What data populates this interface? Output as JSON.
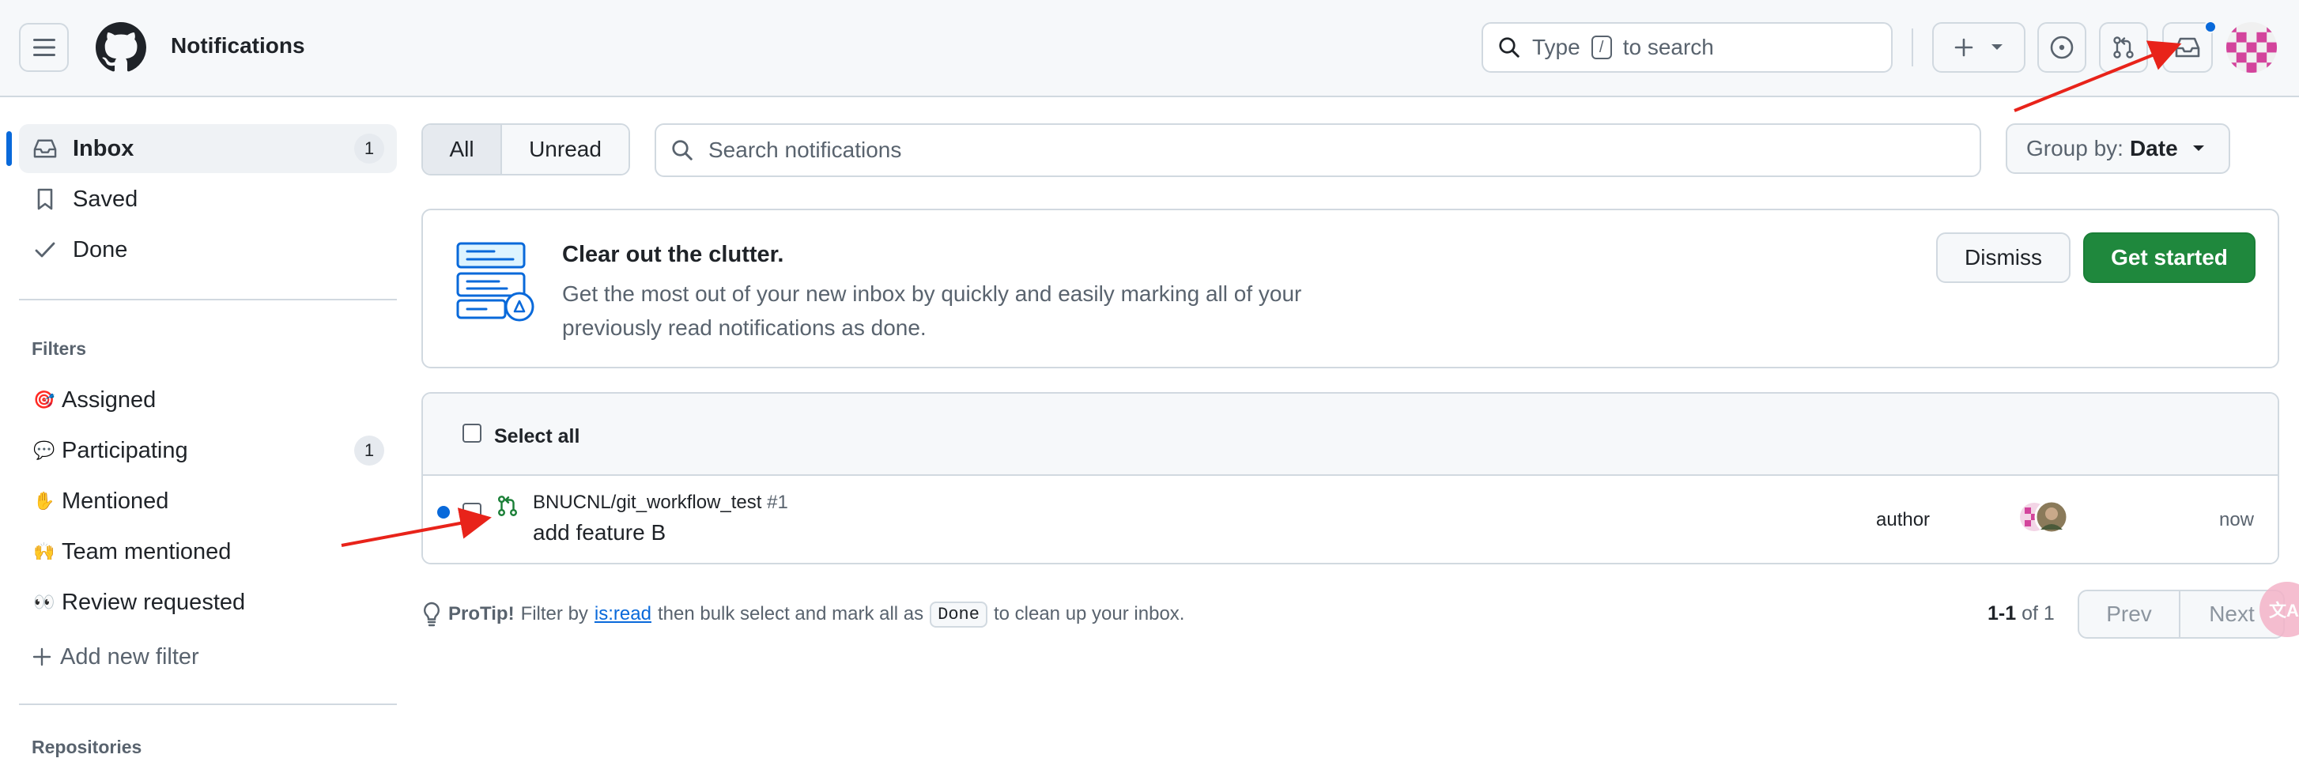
{
  "header": {
    "title": "Notifications",
    "search_prefix": "Type",
    "search_key": "/",
    "search_suffix": "to search"
  },
  "sidebar": {
    "items": [
      {
        "label": "Inbox",
        "count": "1"
      },
      {
        "label": "Saved"
      },
      {
        "label": "Done"
      }
    ],
    "filters_heading": "Filters",
    "filters": [
      {
        "emoji": "🎯",
        "label": "Assigned"
      },
      {
        "emoji": "💬",
        "label": "Participating",
        "count": "1"
      },
      {
        "emoji": "✋",
        "label": "Mentioned"
      },
      {
        "emoji": "🙌",
        "label": "Team mentioned"
      },
      {
        "emoji": "👀",
        "label": "Review requested"
      }
    ],
    "add_filter": "Add new filter",
    "repositories_heading": "Repositories"
  },
  "toolbar": {
    "tab_all": "All",
    "tab_unread": "Unread",
    "search_placeholder": "Search notifications",
    "groupby_label": "Group by:",
    "groupby_value": "Date"
  },
  "banner": {
    "title": "Clear out the clutter.",
    "description": "Get the most out of your new inbox by quickly and easily marking all of your previously read notifications as done.",
    "dismiss": "Dismiss",
    "get_started": "Get started"
  },
  "list": {
    "select_all": "Select all",
    "rows": [
      {
        "repo": "BNUCNL/git_workflow_test",
        "number": "#1",
        "title": "add feature B",
        "reason": "author",
        "time": "now",
        "unread": true
      }
    ]
  },
  "footer": {
    "protip_label": "ProTip!",
    "protip_1": "Filter by",
    "protip_link": "is:read",
    "protip_2": "then bulk select and mark all as",
    "protip_chip": "Done",
    "protip_3": "to clean up your inbox.",
    "range": "1-1",
    "of": "of",
    "total": "1",
    "prev": "Prev",
    "next": "Next"
  },
  "colors": {
    "accent": "#0969da",
    "primary_button": "#1f883d",
    "annotation_arrow": "#e8231a"
  }
}
